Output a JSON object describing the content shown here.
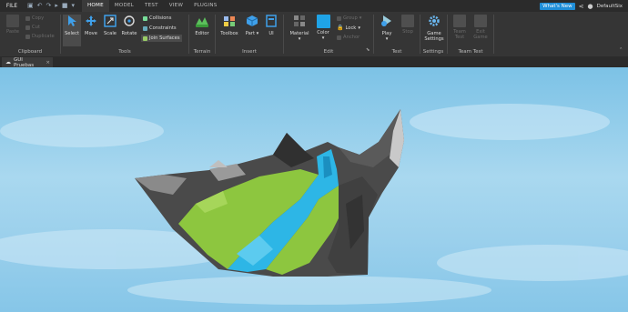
{
  "menubar": {
    "file": "FILE",
    "tabs": [
      {
        "label": "HOME",
        "active": true
      },
      {
        "label": "MODEL",
        "active": false
      },
      {
        "label": "TEST",
        "active": false
      },
      {
        "label": "VIEW",
        "active": false
      },
      {
        "label": "PLUGINS",
        "active": false
      }
    ],
    "whats_new": "What's New",
    "username": "DefaultSix"
  },
  "ribbon": {
    "clipboard": {
      "label": "Clipboard",
      "paste": "Paste",
      "copy": "Copy",
      "cut": "Cut",
      "duplicate": "Duplicate"
    },
    "tools": {
      "label": "Tools",
      "select": "Select",
      "move": "Move",
      "scale": "Scale",
      "rotate": "Rotate",
      "collisions": "Collisions",
      "constraints": "Constraints",
      "join_surfaces": "Join Surfaces"
    },
    "terrain": {
      "label": "Terrain",
      "editor": "Editor"
    },
    "insert": {
      "label": "Insert",
      "toolbox": "Toolbox",
      "part": "Part",
      "ui": "UI"
    },
    "edit": {
      "label": "Edit",
      "material": "Material",
      "color": "Color",
      "group": "Group",
      "lock": "Lock",
      "anchor": "Anchor"
    },
    "test": {
      "label": "Test",
      "play": "Play",
      "stop": "Stop"
    },
    "settings": {
      "label": "Settings",
      "game_settings": "Game Settings"
    },
    "team_test": {
      "label": "Team Test",
      "team_test_btn": "Team Test",
      "exit_game": "Exit Game"
    }
  },
  "document": {
    "tab_label": "GUI Pruebas"
  },
  "colors": {
    "accent": "#1f8ed8",
    "grass": "#8dc63f",
    "water": "#2db6e6",
    "rock": "#555555"
  }
}
